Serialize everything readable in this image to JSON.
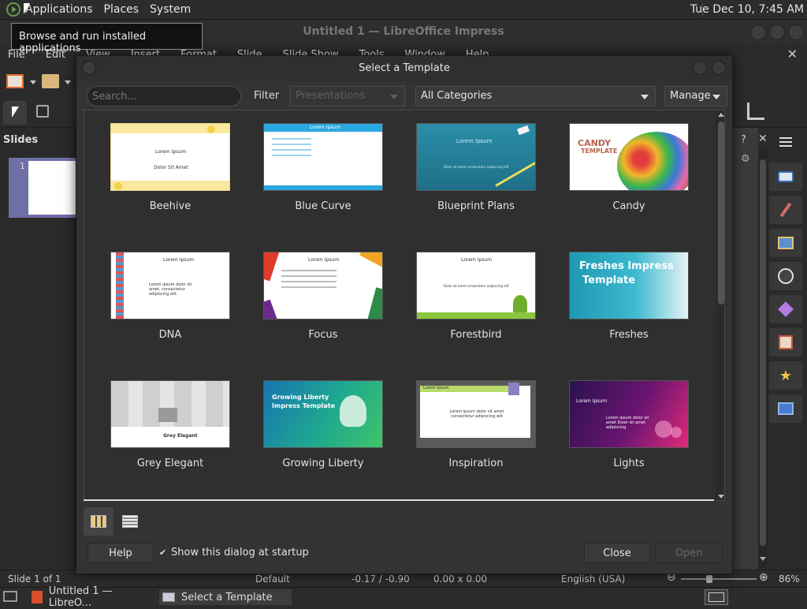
{
  "top_panel": {
    "menus": [
      "Applications",
      "Places",
      "System"
    ],
    "clock": "Tue Dec 10, 7:45 AM"
  },
  "tooltip": "Browse and run installed applications",
  "main_window": {
    "title": "Untitled 1 — LibreOffice Impress",
    "menus": [
      "File",
      "Edit",
      "View",
      "Insert",
      "Format",
      "Slide",
      "Slide Show",
      "Tools",
      "Window",
      "Help"
    ]
  },
  "slides_pane": {
    "title": "Slides",
    "slide_number": "1"
  },
  "status_bar": {
    "slide": "Slide 1 of 1",
    "layout": "Default",
    "position": "-0.17 / -0.90",
    "size": "0.00 x 0.00",
    "language": "English (USA)",
    "zoom": "86%",
    "zoom_level": 0.38
  },
  "taskbar": {
    "tasks": [
      "Untitled 1 — LibreO...",
      "Select a Template"
    ]
  },
  "dialog": {
    "title": "Select a Template",
    "search_placeholder": "Search...",
    "filter_label": "Filter",
    "filter_value": "Presentations",
    "category_value": "All Categories",
    "manage_label": "Manage",
    "templates": [
      {
        "name": "Beehive",
        "line1": "Lorem Ipsum",
        "line2": "Dolor Sit Amet"
      },
      {
        "name": "Blue Curve",
        "line1": "Lorem Ipsum"
      },
      {
        "name": "Blueprint Plans",
        "line1": "Lorem Ipsum",
        "line2": "Dolor sit amet consectetur adipiscing elit"
      },
      {
        "name": "Candy",
        "line1": "CANDY",
        "line2": "TEMPLATE"
      },
      {
        "name": "DNA",
        "line1": "Lorem Ipsum",
        "line2": "Lorem ipsum dolor sit amet, consectetur adipiscing elit."
      },
      {
        "name": "Focus",
        "line1": "Lorem Ipsum"
      },
      {
        "name": "Forestbird",
        "line1": "Lorem Ipsum",
        "line2": "Dolor sit amet consectetur adipiscing elit"
      },
      {
        "name": "Freshes",
        "line1": "Freshes Impress",
        "line2": "Template"
      },
      {
        "name": "Grey Elegant",
        "line1": "Grey Elegant"
      },
      {
        "name": "Growing Liberty",
        "line1": "Growing Liberty",
        "line2": "Impress Template"
      },
      {
        "name": "Inspiration",
        "line1": "Lorem Ipsum",
        "line2": "Lorem ipsum dolor sit amet consectetur adipiscing elit"
      },
      {
        "name": "Lights",
        "line1": "Lorem Ipsum",
        "line2": "Lorem ipsum dolor sit amet Dolor sit amet adipiscing"
      }
    ],
    "help_label": "Help",
    "startup_label": "Show this dialog at startup",
    "close_label": "Close",
    "open_label": "Open"
  }
}
